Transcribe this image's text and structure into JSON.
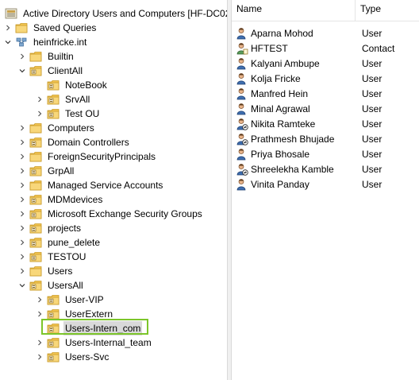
{
  "tree": {
    "root": {
      "label": "Active Directory Users and Computers [HF-DC02."
    },
    "saved_queries": {
      "label": "Saved Queries"
    },
    "domain": {
      "label": "heinfricke.int"
    },
    "builtin": {
      "label": "Builtin"
    },
    "clientall": {
      "label": "ClientAll"
    },
    "notebook": {
      "label": "NoteBook"
    },
    "srvall": {
      "label": "SrvAll"
    },
    "test_ou": {
      "label": "Test OU"
    },
    "computers": {
      "label": "Computers"
    },
    "domain_controllers": {
      "label": "Domain Controllers"
    },
    "foreign_security_principals": {
      "label": "ForeignSecurityPrincipals"
    },
    "grpall": {
      "label": "GrpAll"
    },
    "managed_service_accounts": {
      "label": "Managed Service Accounts"
    },
    "mdmdevices": {
      "label": "MDMdevices"
    },
    "exchange_groups": {
      "label": "Microsoft Exchange Security Groups"
    },
    "projects": {
      "label": "projects"
    },
    "pune_delete": {
      "label": "pune_delete"
    },
    "testou": {
      "label": "TESTOU"
    },
    "users": {
      "label": "Users"
    },
    "usersall": {
      "label": "UsersAll"
    },
    "user_vip": {
      "label": "User-VIP"
    },
    "userextern": {
      "label": "UserExtern"
    },
    "users_intern_com": {
      "label": "Users-Intern_com"
    },
    "users_internal_team": {
      "label": "Users-Internal_team"
    },
    "users_svc": {
      "label": "Users-Svc"
    }
  },
  "list": {
    "columns": {
      "name": "Name",
      "type": "Type"
    },
    "rows": [
      {
        "name": "Aparna Mohod",
        "type": "User",
        "icon": "user-icon"
      },
      {
        "name": "HFTEST",
        "type": "Contact",
        "icon": "contact-icon"
      },
      {
        "name": "Kalyani Ambupe",
        "type": "User",
        "icon": "user-icon"
      },
      {
        "name": "Kolja Fricke",
        "type": "User",
        "icon": "user-icon"
      },
      {
        "name": "Manfred Hein",
        "type": "User",
        "icon": "user-icon"
      },
      {
        "name": "Minal Agrawal",
        "type": "User",
        "icon": "user-icon"
      },
      {
        "name": "Nikita Ramteke",
        "type": "User",
        "icon": "disabled-user-icon"
      },
      {
        "name": "Prathmesh Bhujade",
        "type": "User",
        "icon": "disabled-user-icon"
      },
      {
        "name": "Priya Bhosale",
        "type": "User",
        "icon": "user-icon"
      },
      {
        "name": "Shreelekha Kamble",
        "type": "User",
        "icon": "disabled-user-icon"
      },
      {
        "name": "Vinita Panday",
        "type": "User",
        "icon": "user-icon"
      }
    ]
  },
  "colors": {
    "selection_outline": "#7cc52a",
    "selection_fill": "#d9d9d9",
    "folder": "#f3c552"
  }
}
